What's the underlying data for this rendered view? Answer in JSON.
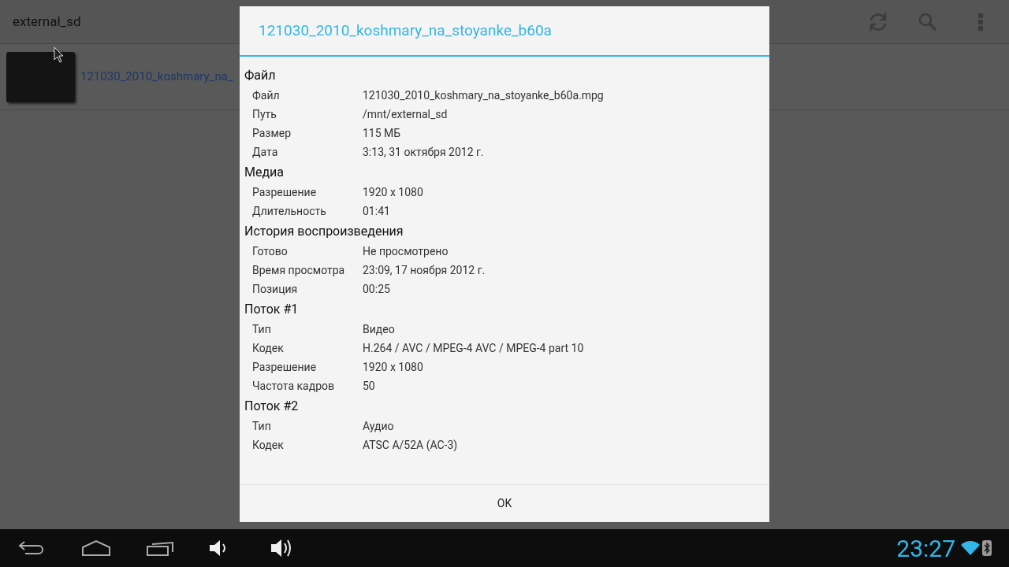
{
  "action_bar": {
    "title": "external_sd"
  },
  "files": [
    {
      "name": "121030_2010_koshmary_na_"
    }
  ],
  "dialog": {
    "title": "121030_2010_koshmary_na_stoyanke_b60a",
    "sections": [
      {
        "heading": "Файл",
        "rows": [
          {
            "label": "Файл",
            "value": "121030_2010_koshmary_na_stoyanke_b60a.mpg"
          },
          {
            "label": "Путь",
            "value": "/mnt/external_sd"
          },
          {
            "label": "Размер",
            "value": "115 МБ"
          },
          {
            "label": "Дата",
            "value": "3:13, 31 октября 2012 г."
          }
        ]
      },
      {
        "heading": "Медиа",
        "rows": [
          {
            "label": "Разрешение",
            "value": "1920 x 1080"
          },
          {
            "label": "Длительность",
            "value": "01:41"
          }
        ]
      },
      {
        "heading": "История воспроизведения",
        "rows": [
          {
            "label": "Готово",
            "value": "Не просмотрено"
          },
          {
            "label": "Время просмотра",
            "value": "23:09, 17 ноября 2012 г."
          },
          {
            "label": "Позиция",
            "value": "00:25"
          }
        ]
      },
      {
        "heading": "Поток #1",
        "rows": [
          {
            "label": "Тип",
            "value": "Видео"
          },
          {
            "label": "Кодек",
            "value": "H.264 / AVC / MPEG-4 AVC / MPEG-4 part 10"
          },
          {
            "label": "Разрешение",
            "value": "1920 x 1080"
          },
          {
            "label": "Частота кадров",
            "value": "50"
          }
        ]
      },
      {
        "heading": "Поток #2",
        "rows": [
          {
            "label": "Тип",
            "value": "Аудио"
          },
          {
            "label": "Кодек",
            "value": "ATSC A/52A (AC-3)"
          }
        ]
      }
    ],
    "button": "OK"
  },
  "status_bar": {
    "time": "23:27"
  }
}
